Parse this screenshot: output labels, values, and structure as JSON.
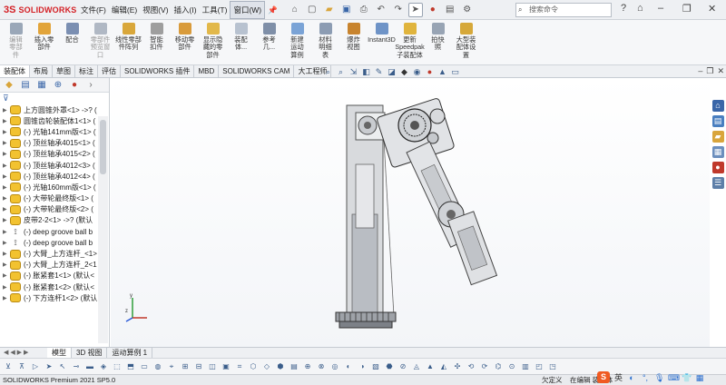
{
  "app": {
    "logo_ds": "3S",
    "logo_text": "SOLIDWORKS"
  },
  "menu": [
    {
      "label": "文件(F)"
    },
    {
      "label": "编辑(E)"
    },
    {
      "label": "视图(V)"
    },
    {
      "label": "插入(I)"
    },
    {
      "label": "工具(T)"
    },
    {
      "label": "窗口(W)"
    }
  ],
  "search": {
    "placeholder": "搜索命令"
  },
  "ribbon": [
    {
      "label": "编辑\n零部\n件",
      "disabled": true,
      "color": "#9aa7b8"
    },
    {
      "label": "插入零\n部件",
      "disabled": false,
      "color": "#e2a43a"
    },
    {
      "label": "配合",
      "disabled": false,
      "color": "#7b8fb2"
    },
    {
      "label": "零部件\n预览窗\n口",
      "disabled": true,
      "color": "#b0b8c4"
    },
    {
      "label": "线性零部\n件阵列",
      "disabled": false,
      "color": "#d9a73b"
    },
    {
      "label": "智能\n扣件",
      "disabled": false,
      "color": "#9e9e9e"
    },
    {
      "label": "移动零\n部件",
      "disabled": false,
      "color": "#d99b3b"
    },
    {
      "label": "显示隐\n藏的零\n部件",
      "disabled": false,
      "color": "#e2b84a"
    },
    {
      "label": "装配\n体...",
      "disabled": false,
      "color": "#b8c2d0"
    },
    {
      "label": "参考\n几...",
      "disabled": false,
      "color": "#7f8fa8"
    },
    {
      "label": "新建\n运动\n算例",
      "disabled": false,
      "color": "#7aa3d6"
    },
    {
      "label": "材料\n明细\n表",
      "disabled": false,
      "color": "#8c9cb3"
    },
    {
      "label": "爆炸\n视图",
      "disabled": false,
      "color": "#c8842e"
    },
    {
      "label": "Instant3D",
      "disabled": false,
      "color": "#6e93c7"
    },
    {
      "label": "更新\nSpeedpak\n子装配体",
      "disabled": false,
      "color": "#e0b43d"
    },
    {
      "label": "拍快\n照",
      "disabled": false,
      "color": "#98a4b4"
    },
    {
      "label": "大型装\n配体设\n置",
      "disabled": false,
      "color": "#d6a83a"
    }
  ],
  "tabs": [
    {
      "label": "装配体"
    },
    {
      "label": "布局"
    },
    {
      "label": "草图"
    },
    {
      "label": "标注"
    },
    {
      "label": "评估"
    },
    {
      "label": "SOLIDWORKS 插件"
    },
    {
      "label": "MBD"
    },
    {
      "label": "SOLIDWORKS CAM"
    },
    {
      "label": "大工程师"
    }
  ],
  "tree": [
    {
      "label": "上方圆锥外罩<1> ->? (",
      "icon": "part"
    },
    {
      "label": "圆锥齿轮装配体1<1> (",
      "icon": "part"
    },
    {
      "label": "(-) 光轴141mm版<1> (",
      "icon": "part"
    },
    {
      "label": "(-) 顶丝轴承4015<1> (",
      "icon": "part"
    },
    {
      "label": "(-) 顶丝轴承4015<2> (",
      "icon": "part"
    },
    {
      "label": "(-) 顶丝轴承4012<3> (",
      "icon": "part"
    },
    {
      "label": "(-) 顶丝轴承4012<4> (",
      "icon": "part"
    },
    {
      "label": "(-) 光轴160mm版<1> (",
      "icon": "part"
    },
    {
      "label": "(-) 大带轮最终版<1> (",
      "icon": "part"
    },
    {
      "label": "(-) 大带轮最终版<2> (",
      "icon": "part"
    },
    {
      "label": "皮带2-2<1> ->? (默认",
      "icon": "part"
    },
    {
      "label": "(-) deep groove ball b",
      "icon": "bolt"
    },
    {
      "label": "(-) deep groove ball b",
      "icon": "bolt"
    },
    {
      "label": "(-) 大臂_上方连杆_<1>",
      "icon": "part"
    },
    {
      "label": "(-) 大臂_上方连杆_2<1",
      "icon": "part"
    },
    {
      "label": "(-) 胀紧套1<1> (默认<",
      "icon": "part"
    },
    {
      "label": "(-) 胀紧套1<2> (默认<",
      "icon": "part"
    },
    {
      "label": "(-) 下方连杆1<2> (默认",
      "icon": "part"
    }
  ],
  "bottom_tabs": [
    {
      "label": "模型"
    },
    {
      "label": "3D 视图"
    },
    {
      "label": "运动算例 1"
    }
  ],
  "status": {
    "version": "SOLIDWORKS Premium 2021 SP5.0",
    "undefined": "欠定义",
    "editing": "在编辑 装配体"
  },
  "ime": {
    "logo": "S",
    "lang": "英"
  },
  "triad": {
    "x": "x",
    "y": "y",
    "z": "z"
  }
}
